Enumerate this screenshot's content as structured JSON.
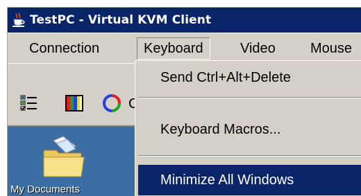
{
  "window": {
    "title": "TestPC - Virtual KVM Client",
    "icon": "java-cup-icon"
  },
  "menubar": {
    "items": [
      {
        "label": "Connection"
      },
      {
        "label": "Keyboard",
        "open": true
      },
      {
        "label": "Video"
      },
      {
        "label": "Mouse"
      }
    ]
  },
  "toolbar": {
    "buttons": [
      {
        "icon": "properties-list-icon"
      },
      {
        "icon": "color-palette-icon"
      },
      {
        "icon": "refresh-video-icon"
      }
    ],
    "cutoff_glyph": "C"
  },
  "dropdown": {
    "items": [
      {
        "label": "Send Ctrl+Alt+Delete",
        "highlighted": false
      },
      {
        "label": "Keyboard Macros...",
        "highlighted": false
      },
      {
        "label": "Minimize All Windows",
        "highlighted": true
      }
    ]
  },
  "desktop": {
    "icons": [
      {
        "label": "My Documents",
        "icon": "my-documents-folder-icon"
      }
    ]
  },
  "colors": {
    "titlebar": "#0a246a",
    "face": "#d4d0c8",
    "highlight": "#0a246a",
    "desktop": "#3a6ea5"
  }
}
